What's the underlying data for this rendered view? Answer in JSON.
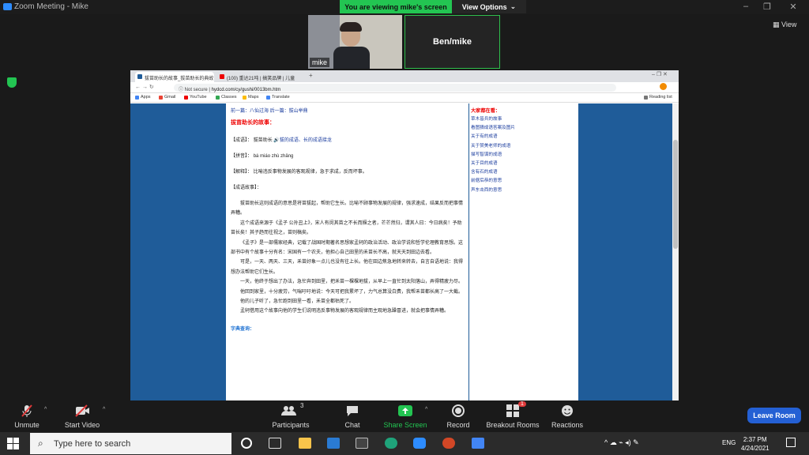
{
  "window": {
    "title": "Zoom Meeting - Mike"
  },
  "banner": {
    "viewing": "You are viewing mike's screen",
    "view_options": "View Options"
  },
  "view_label": "View",
  "participants": {
    "cam1_name": "mike",
    "cam2_name": "Ben/mike"
  },
  "browser": {
    "tabs": [
      {
        "label": "拔苗助长的故事_拔苗助长的典故"
      },
      {
        "label": "(100) 重达21吨 | 搞笑品牌 | 儿童"
      }
    ],
    "address": {
      "security": "Not secure",
      "url": "hydcd.com/cy/gushi/0013bm.htm"
    },
    "bookmarks": [
      "Apps",
      "Gmail",
      "YouTube",
      "Classes",
      "Maps",
      "Translate"
    ],
    "reading_list": "Reading list"
  },
  "article": {
    "nav": "前一篇：八仙过海 后一篇：拔山举鼎",
    "title": "拔苗助长的故事：",
    "idiom_label": "【成语】：",
    "idiom_value": "拔苗助长",
    "idiom_link": "拔的成语、长的成语接龙",
    "pinyin_label": "【拼音】：",
    "pinyin_value": "bá miáo zhù zhǎng",
    "explain_label": "【解释】：",
    "explain_value": "比喻违反事物发展的客观规律，急于求成，反而坏事。",
    "story_label": "【成语故事】：",
    "paragraphs": [
      "拔苗助长这则成语的意思是将苗拔起，帮助它生长。比喻不顾事物发展的规律，强求速成，结果反而把事情弄糟。",
      "这个成语来源于《孟子 公孙丑上》，宋人有闵其苗之不长而揠之者，芒芒然归，谓其人曰：今日病矣！予助苗长矣！其子趋而往视之，苗则槁矣。",
      "《孟子》是一部儒家经典，记载了战国时期著名思想家孟轲的政治活动、政治学说和哲学伦理教育思想。这部书中有个故事十分有名：宋国有一个农夫，他担心自己田里的禾苗长不高，就天天到田边去看。",
      "可是，一天、两天、三天，禾苗好象一点儿也没有往上长。他在田边焦急地转来转去，自言自语地说：我得想办法帮助它们生长。",
      "一天，他终于想出了办法，急忙奔到田里，把禾苗一棵棵地拔，从早上一直忙到太阳落山，弄得精疲力尽。",
      "他回到家里，十分疲劳，气喘吁吁地说：今天可把我累坏了，力气总算没白费，我帮禾苗都长高了一大截。",
      "他的儿子听了，急忙跑到田里一看，禾苗全都枯死了。",
      "孟轲借用这个故事向他的学生们说明违反事物发展的客观规律而主观地急躁冒进，就会把事情弄糟。"
    ],
    "dict_label": "字典查询："
  },
  "sidebar": {
    "heading": "大家都在看：",
    "links": [
      "草木皆兵的故事",
      "看图猜成语答案及图片",
      "关于有的成语",
      "关于赞美老师的成语",
      "描写智谋的成语",
      "关于目的成语",
      "含有石的成语",
      "前倨后恭的意思",
      "声东击西的意思"
    ]
  },
  "toolbar": {
    "unmute": "Unmute",
    "start_video": "Start Video",
    "participants": "Participants",
    "participants_count": "3",
    "chat": "Chat",
    "share_screen": "Share Screen",
    "record": "Record",
    "breakout": "Breakout Rooms",
    "breakout_badge": "1",
    "reactions": "Reactions",
    "leave": "Leave Room"
  },
  "taskbar": {
    "search_placeholder": "Type here to search",
    "lang": "ENG",
    "time": "2:37 PM",
    "date": "4/24/2021"
  }
}
